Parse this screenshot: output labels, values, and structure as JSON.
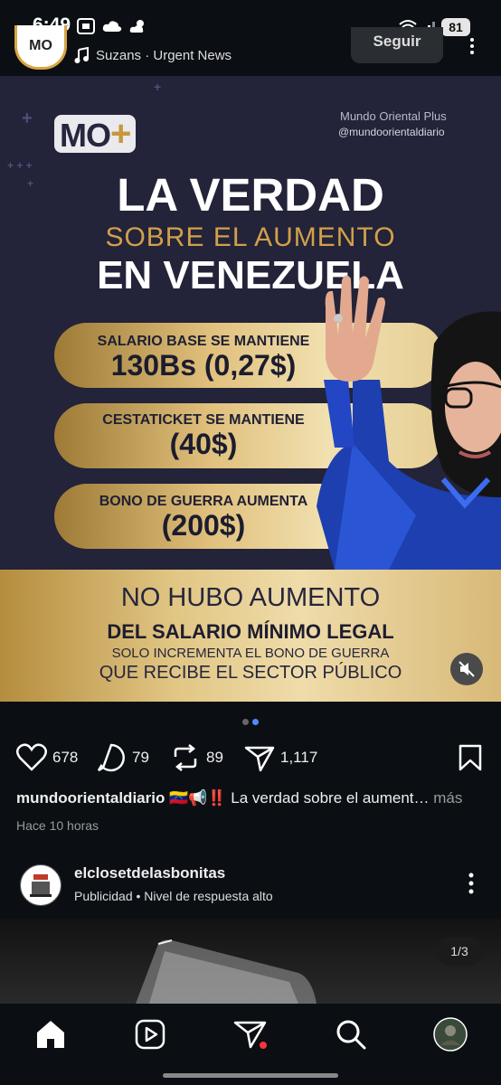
{
  "status_bar": {
    "time": "6:49",
    "battery": "81"
  },
  "post_header": {
    "avatar_text": "MO",
    "audio_track": "Suzans · Urgent News",
    "follow_label": "Seguir"
  },
  "post_image": {
    "logo_text": "MO",
    "logo_plus": "+",
    "brand_name": "Mundo Oriental Plus",
    "brand_handle": "@mundoorientaldiario",
    "headline_1": "LA VERDAD",
    "headline_2": "SOBRE EL AUMENTO",
    "headline_3": "EN VENEZUELA",
    "pills": [
      {
        "label": "SALARIO BASE SE MANTIENE",
        "value": "130Bs (0,27$)"
      },
      {
        "label": "CESTATICKET SE MANTIENE",
        "value": "(40$)"
      },
      {
        "label": "BONO DE GUERRA AUMENTA",
        "value": "(200$)"
      }
    ],
    "banner_line_1": "NO HUBO AUMENTO",
    "banner_line_2": "DEL SALARIO MÍNIMO LEGAL",
    "banner_line_3": "SOLO INCREMENTA EL BONO DE GUERRA",
    "banner_line_4": "QUE RECIBE EL SECTOR PÚBLICO"
  },
  "carousel": {
    "total": 2,
    "active": 1
  },
  "actions": {
    "likes": "678",
    "comments": "79",
    "reposts": "89",
    "shares": "1,117"
  },
  "caption": {
    "username": "mundoorientaldiario",
    "text": " 🇻🇪📢‼️ La verdad sobre el aument…",
    "more": " más",
    "time_ago": "Hace 10 horas"
  },
  "next_post": {
    "username": "elclosetdelasbonitas",
    "subtitle": "Publicidad • Nivel de respuesta alto",
    "counter": "1/3"
  },
  "colors": {
    "background": "#0b0f14",
    "gold": "#d1a04a",
    "navy": "#232339",
    "notification_dot": "#ff3040"
  },
  "icons": {
    "like": "heart-icon",
    "comment": "comment-icon",
    "repost": "repost-icon",
    "share": "send-icon",
    "save": "bookmark-icon",
    "home": "home-icon",
    "reels": "reels-icon",
    "direct": "direct-icon",
    "search": "search-icon",
    "profile": "profile-avatar"
  }
}
